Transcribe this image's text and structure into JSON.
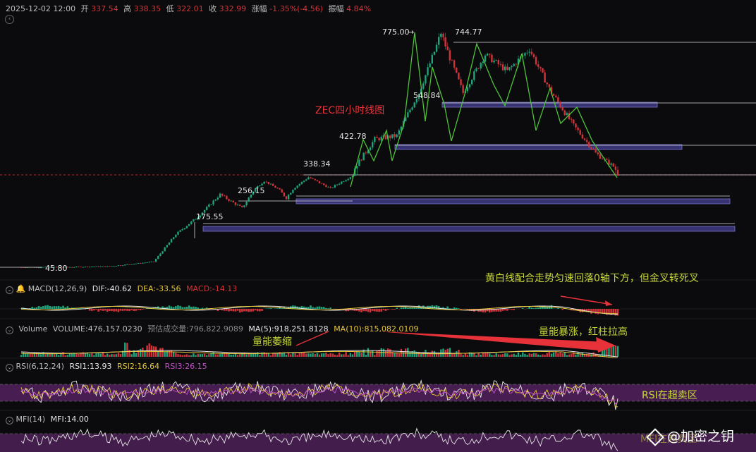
{
  "header": {
    "datetime": "2025-12-02 12:00",
    "open_label": "开",
    "open": "337.54",
    "high_label": "高",
    "high": "338.35",
    "low_label": "低",
    "low": "322.01",
    "close_label": "收",
    "close": "332.99",
    "change_label": "涨幅",
    "change": "-1.35%(-4.56)",
    "amplitude_label": "振幅",
    "amplitude": "4.84%"
  },
  "colors": {
    "up": "#1fa37a",
    "down": "#d0343a",
    "zone": "#3a3578",
    "purple": "#7b2f8c",
    "yellow": "#e6c63a",
    "annotation": "#c8d93a",
    "title": "#e8323a"
  },
  "chart_data": [
    {
      "type": "candlestick",
      "title": "ZEC四小时线图",
      "price_labels": [
        "775.00",
        "744.77",
        "548.84",
        "422.78",
        "338.34",
        "256.15",
        "175.55",
        "45.80"
      ],
      "approx_path": {
        "x_index": [
          0,
          20,
          40,
          60,
          70,
          80,
          90,
          100,
          110,
          120,
          130,
          140,
          150,
          160,
          170,
          180,
          190,
          200,
          210,
          220,
          230,
          240,
          250,
          260,
          270
        ],
        "close": [
          45.8,
          46,
          48,
          60,
          130,
          175,
          240,
          200,
          300,
          230,
          320,
          260,
          330,
          420,
          430,
          560,
          775,
          560,
          700,
          640,
          720,
          560,
          460,
          380,
          333
        ]
      },
      "support_zones": [
        548.84,
        422.78,
        256.15,
        175.55
      ],
      "current_price_line": 332.99
    },
    {
      "type": "line",
      "name": "MACD",
      "params": "MACD(12,26,9)",
      "dif_label": "DIF:",
      "dif": "-40.62",
      "dea_label": "DEA:",
      "dea": "-33.56",
      "macd_label": "MACD:",
      "macd": "-14.13",
      "annotation": "黄白线配合走势匀速回落0轴下方，但金叉转死叉"
    },
    {
      "type": "bar",
      "name": "Volume",
      "volume_label": "VOLUME:",
      "volume": "476,157.0230",
      "forecast_label": "预估成交量:",
      "forecast": "796,822.9089",
      "ma5_label": "MA(5):",
      "ma5": "918,251.8128",
      "ma10_label": "MA(10):",
      "ma10": "815,082.0109",
      "annotation_left": "量能萎缩",
      "annotation_right": "量能暴涨，红柱拉高"
    },
    {
      "type": "line",
      "name": "RSI",
      "params": "RSI(6,12,24)",
      "rsi1_label": "RSI1:",
      "rsi1": "13.93",
      "rsi2_label": "RSI2:",
      "rsi2": "16.64",
      "rsi3_label": "RSI3:",
      "rsi3": "26.15",
      "annotation": "RSI在超卖区"
    },
    {
      "type": "line",
      "name": "MFI",
      "params": "MFI(14)",
      "mfi_label": "MFI:",
      "mfi": "14.00",
      "annotation": "MFI在超卖区"
    }
  ],
  "watermark": "@加密之钥"
}
